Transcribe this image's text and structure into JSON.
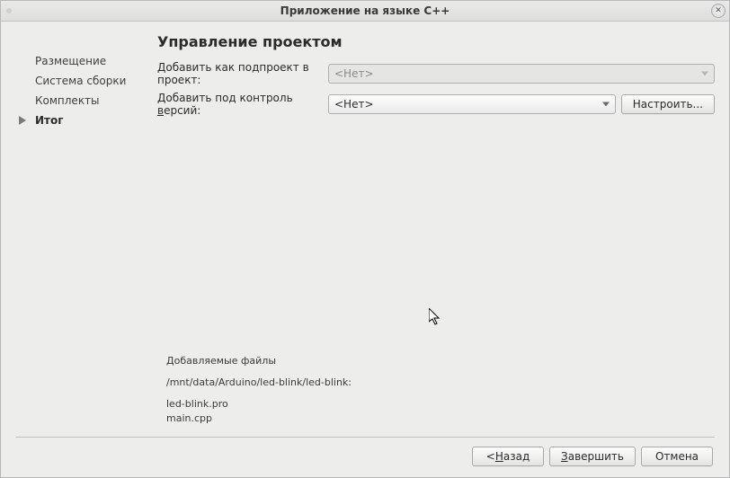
{
  "window": {
    "title": "Приложение на языке С++"
  },
  "sidebar": {
    "steps": [
      {
        "label": "Размещение"
      },
      {
        "label": "Система сборки"
      },
      {
        "label": "Комплекты"
      },
      {
        "label": "Итог"
      }
    ],
    "active_index": 3
  },
  "main": {
    "heading": "Управление проектом",
    "subproject": {
      "label": "Добавить как подпроект в проект:",
      "value": "<Нет>"
    },
    "vcs": {
      "label_pre": "Добавить под контроль ",
      "label_accel": "в",
      "label_post": "ерсий:",
      "value": "<Нет>",
      "configure_label": "Настроить..."
    },
    "files": {
      "caption": "Добавляемые файлы",
      "path": "/mnt/data/Arduino/led-blink/led-blink:",
      "list": [
        "led-blink.pro",
        "main.cpp"
      ]
    }
  },
  "footer": {
    "back": {
      "pre": "< ",
      "accel": "Н",
      "post": "азад"
    },
    "finish": {
      "accel": "З",
      "post": "авершить"
    },
    "cancel": {
      "label": "Отмена"
    }
  }
}
